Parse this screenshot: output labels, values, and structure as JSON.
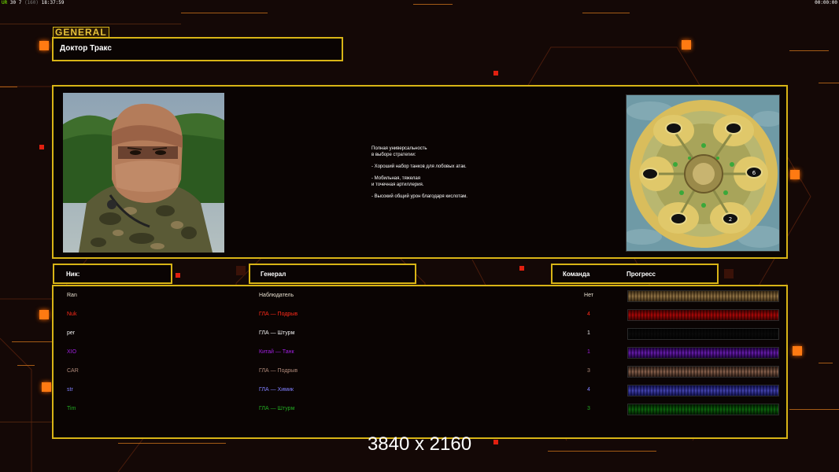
{
  "status": {
    "left_a": "UR",
    "left_b": "30 7",
    "left_c": "(160)",
    "left_d": "18:37:59",
    "right": "00:00:00"
  },
  "header": {
    "brand": "GENERAL",
    "title": "Доктор Тракс"
  },
  "general_panel": {
    "description": "Полная универсальность\nв выборе стратегии:\n\n- Хороший набор танков для лобовых атак.\n\n- Мобильная, тяжелая\nи точечная артиллерия.\n\n- Высокий общий урон благодаря кислотам."
  },
  "columns": {
    "nick": "Ник:",
    "general": "Генерал",
    "team": "Команда",
    "progress": "Прогресс"
  },
  "players": [
    {
      "nick": "Ran",
      "general": "Наблюдатель",
      "team": "Нет",
      "color": "#e8e0d0",
      "team_color": "#e8e0d0",
      "bar": [
        "#5a4a30",
        "#cdb890"
      ]
    },
    {
      "nick": "Nuk",
      "general": "ГЛА — Подрыв",
      "team": "4",
      "color": "#ff2a1a",
      "team_color": "#ff2a1a",
      "bar": [
        "#5a0a0a",
        "#e03030"
      ]
    },
    {
      "nick": "per",
      "general": "ГЛА — Штурм",
      "team": "1",
      "color": "#f0f0f0",
      "team_color": "#f0f0f0",
      "bar": [
        "#101010",
        "#3a3a3a"
      ]
    },
    {
      "nick": "XIO",
      "general": "Китай — Танк",
      "team": "1",
      "color": "#a020e0",
      "team_color": "#a020e0",
      "bar": [
        "#3a0a5a",
        "#b060e0"
      ]
    },
    {
      "nick": "CAR",
      "general": "ГЛА — Подрыв",
      "team": "3",
      "color": "#b08a7a",
      "team_color": "#b08a7a",
      "bar": [
        "#4a3a30",
        "#c8aa98"
      ]
    },
    {
      "nick": "str",
      "general": "ГЛА — Химик",
      "team": "4",
      "color": "#8080ff",
      "team_color": "#8080ff",
      "bar": [
        "#2a2a6a",
        "#9090e0"
      ]
    },
    {
      "nick": "Tim",
      "general": "ГЛА — Штурм",
      "team": "3",
      "color": "#22aa22",
      "team_color": "#22aa22",
      "bar": [
        "#0a3a0a",
        "#40b040"
      ]
    }
  ],
  "minimap": {
    "slots": [
      "",
      "",
      "",
      "6",
      "",
      "2"
    ]
  },
  "resolution_label": "3840 x 2160"
}
